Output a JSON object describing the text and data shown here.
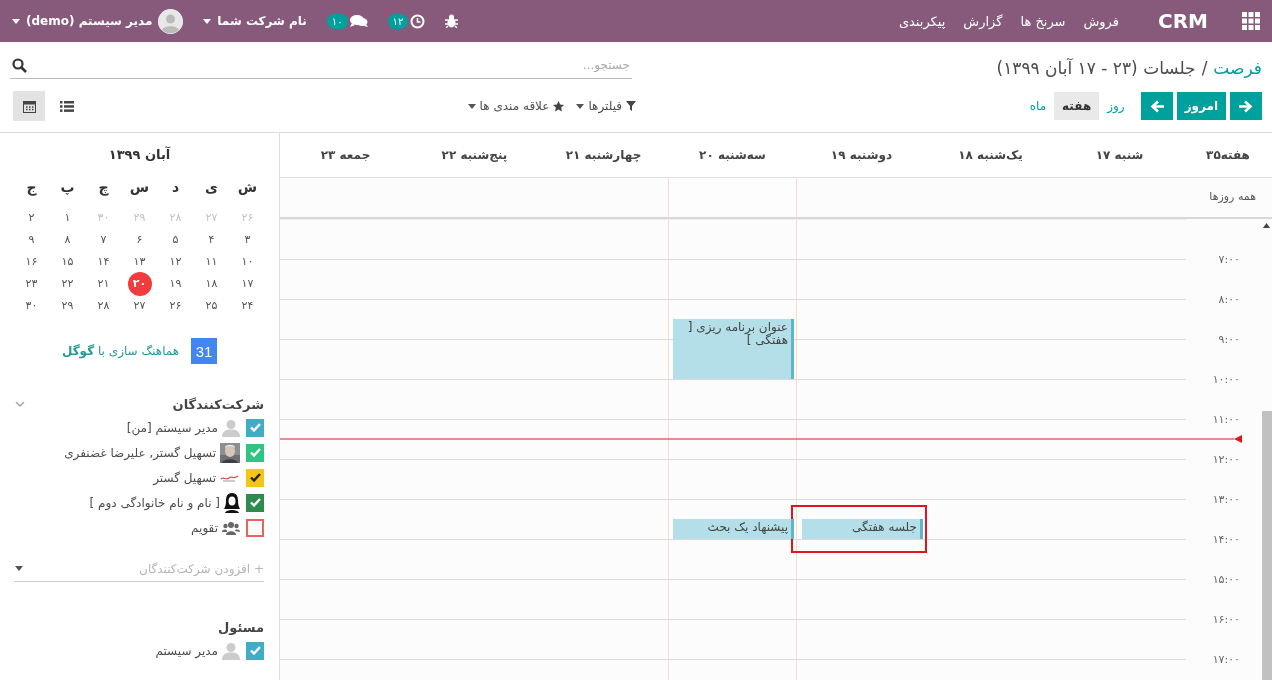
{
  "navbar": {
    "app_name": "CRM",
    "menu": [
      "فروش",
      "سرنخ ها",
      "گزارش",
      "پیکربندی"
    ],
    "activity_count": "۱۲",
    "message_count": "۱۰",
    "company": "نام شرکت شما",
    "user": "مدیر سیستم (demo)"
  },
  "control_panel": {
    "breadcrumb": [
      {
        "label": "فرصت",
        "link": true
      },
      {
        "label": "جلسات (۲۳ - ۱۷ آبان ۱۳۹۹)",
        "link": false
      }
    ],
    "separator": "/",
    "search": {
      "placeholder": "جستجو..."
    },
    "today_button": "امروز",
    "scales": [
      {
        "label": "روز",
        "selected": false
      },
      {
        "label": "هفته",
        "selected": true
      },
      {
        "label": "ماه",
        "selected": false
      }
    ],
    "filters": [
      {
        "kind": "filter",
        "label": "فیلترها"
      },
      {
        "kind": "favorite",
        "label": "علاقه مندی ها"
      }
    ],
    "views": [
      {
        "kind": "calendar",
        "selected": true
      },
      {
        "kind": "list",
        "selected": false
      }
    ]
  },
  "calendar": {
    "week_label": "هفته۳۵",
    "all_day_label": "همه روزها",
    "hours": [
      "۷:۰۰",
      "۸:۰۰",
      "۹:۰۰",
      "۱۰:۰۰",
      "۱۱:۰۰",
      "۱۲:۰۰",
      "۱۳:۰۰",
      "۱۴:۰۰",
      "۱۵:۰۰",
      "۱۶:۰۰",
      "۱۷:۰۰"
    ],
    "days": [
      {
        "label": "شنبه ۱۷",
        "today": false
      },
      {
        "label": "یک‌شنبه ۱۸",
        "today": false
      },
      {
        "label": "دوشنبه ۱۹",
        "today": false,
        "events": [
          {
            "title": "جلسه هفتگی",
            "highlighted": true
          }
        ]
      },
      {
        "label": "سه‌شنبه ۲۰",
        "today": true,
        "events": [
          {
            "title": "عنوان برنامه ریزی [ هفتگی ]",
            "highlighted": false
          },
          {
            "title": "پیشنهاد یک بحث",
            "highlighted": false
          }
        ]
      },
      {
        "label": "چهارشنبه ۲۱",
        "today": false
      },
      {
        "label": "پنج‌شنبه ۲۲",
        "today": false
      },
      {
        "label": "جمعه ۲۳",
        "today": false
      }
    ]
  },
  "sidebar": {
    "mini_calendar": {
      "title": "آبان ۱۳۹۹",
      "weekdays": [
        "ش",
        "ی",
        "د",
        "س",
        "چ",
        "پ",
        "ج"
      ],
      "weeks": [
        [
          {
            "label": "۲۶",
            "muted": true,
            "selected": false
          },
          {
            "label": "۲۷",
            "muted": true,
            "selected": false
          },
          {
            "label": "۲۸",
            "muted": true,
            "selected": false
          },
          {
            "label": "۲۹",
            "muted": true,
            "selected": false
          },
          {
            "label": "۳۰",
            "muted": true,
            "selected": false
          },
          {
            "label": "۱",
            "muted": false,
            "selected": false
          },
          {
            "label": "۲",
            "muted": false,
            "selected": false
          }
        ],
        [
          {
            "label": "۳",
            "muted": false,
            "selected": false
          },
          {
            "label": "۴",
            "muted": false,
            "selected": false
          },
          {
            "label": "۵",
            "muted": false,
            "selected": false
          },
          {
            "label": "۶",
            "muted": false,
            "selected": false
          },
          {
            "label": "۷",
            "muted": false,
            "selected": false
          },
          {
            "label": "۸",
            "muted": false,
            "selected": false
          },
          {
            "label": "۹",
            "muted": false,
            "selected": false
          }
        ],
        [
          {
            "label": "۱۰",
            "muted": false,
            "selected": false
          },
          {
            "label": "۱۱",
            "muted": false,
            "selected": false
          },
          {
            "label": "۱۲",
            "muted": false,
            "selected": false
          },
          {
            "label": "۱۳",
            "muted": false,
            "selected": false
          },
          {
            "label": "۱۴",
            "muted": false,
            "selected": false
          },
          {
            "label": "۱۵",
            "muted": false,
            "selected": false
          },
          {
            "label": "۱۶",
            "muted": false,
            "selected": false
          }
        ],
        [
          {
            "label": "۱۷",
            "muted": false,
            "selected": false
          },
          {
            "label": "۱۸",
            "muted": false,
            "selected": false
          },
          {
            "label": "۱۹",
            "muted": false,
            "selected": false
          },
          {
            "label": "۲۰",
            "muted": false,
            "selected": true
          },
          {
            "label": "۲۱",
            "muted": false,
            "selected": false
          },
          {
            "label": "۲۲",
            "muted": false,
            "selected": false
          },
          {
            "label": "۲۳",
            "muted": false,
            "selected": false
          }
        ],
        [
          {
            "label": "۲۴",
            "muted": false,
            "selected": false
          },
          {
            "label": "۲۵",
            "muted": false,
            "selected": false
          },
          {
            "label": "۲۶",
            "muted": false,
            "selected": false
          },
          {
            "label": "۲۷",
            "muted": false,
            "selected": false
          },
          {
            "label": "۲۸",
            "muted": false,
            "selected": false
          },
          {
            "label": "۲۹",
            "muted": false,
            "selected": false
          },
          {
            "label": "۳۰",
            "muted": false,
            "selected": false
          }
        ]
      ]
    },
    "google_sync": {
      "icon_label": "31",
      "text": "هماهنگ سازی با **گوگل**"
    },
    "attendees": {
      "title": "شرکت‌کنندگان",
      "items": [
        {
          "label": "مدیر سیستم [من]",
          "kind": "user",
          "color": "#3fadc6",
          "checked": true
        },
        {
          "label": "تسهیل گستر, علیرضا غضنفری",
          "color": "#30c381",
          "checked": true
        },
        {
          "label": "تسهیل گستر",
          "kind": "logo",
          "color": "#f4c511",
          "checked": true
        },
        {
          "label": "[ نام و نام خانوادگی دوم ]",
          "kind": "female",
          "color": "#2e8b4e",
          "checked": true
        },
        {
          "label": "تقویم",
          "kind": "group",
          "color": "#e9635a",
          "checked": false
        }
      ],
      "add_placeholder": "+ افزودن شرکت‌کنندگان"
    },
    "responsible": {
      "title": "مسئول",
      "items": [
        {
          "label": "مدیر سیستم",
          "kind": "user",
          "color": "#3fadc6",
          "checked": true
        }
      ]
    }
  }
}
